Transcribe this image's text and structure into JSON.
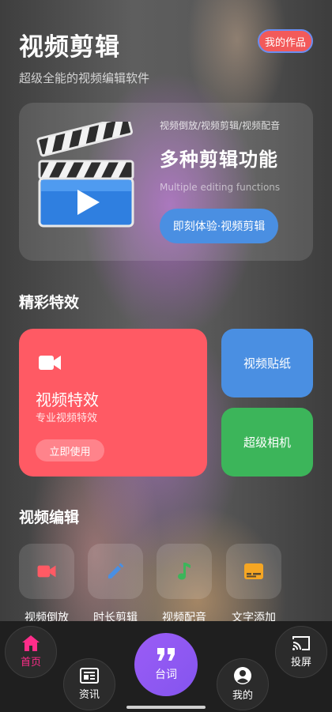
{
  "header": {
    "title": "视频剪辑",
    "subtitle": "超级全能的视频编辑软件",
    "my_works": "我的作品"
  },
  "hero": {
    "tags": "视频倒放/视频剪辑/视频配音",
    "headline": "多种剪辑功能",
    "headline_en": "Multiple editing functions",
    "cta": "即刻体验·视频剪辑"
  },
  "effects": {
    "section_title": "精彩特效",
    "main_card": {
      "name": "视频特效",
      "desc": "专业视频特效",
      "button": "立即使用",
      "color": "#ff5a64"
    },
    "sticker_card": {
      "label": "视频贴纸",
      "color": "#4a8fe2"
    },
    "camera_card": {
      "label": "超级相机",
      "color": "#3cb55a"
    }
  },
  "editing": {
    "section_title": "视频编辑",
    "tools": [
      {
        "label": "视频倒放",
        "icon": "video-camera-icon",
        "color": "#ff5a64"
      },
      {
        "label": "时长剪辑",
        "icon": "pencil-icon",
        "color": "#4a8fe2"
      },
      {
        "label": "视频配音",
        "icon": "music-note-icon",
        "color": "#3cb55a"
      },
      {
        "label": "文字添加",
        "icon": "subtitles-icon",
        "color": "#f5a623"
      }
    ]
  },
  "nav": {
    "home": "首页",
    "news": "资讯",
    "lines": "台词",
    "mine": "我的",
    "cast": "投屏",
    "active_color": "#ff2d8a"
  }
}
